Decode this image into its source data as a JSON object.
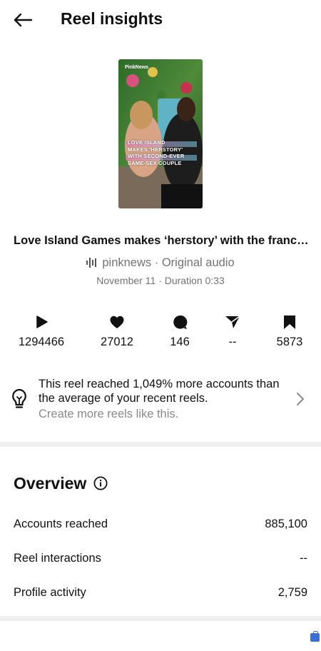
{
  "header": {
    "title": "Reel insights"
  },
  "thumbnail": {
    "brand_text": "PinkNews",
    "caption_lines": [
      "LOVE ISLAND",
      "MAKES 'HERSTORY'",
      "WITH SECOND-EVER",
      "SAME-SEX COUPLE"
    ]
  },
  "reel": {
    "title": "Love Island Games makes ‘herstory’ with the franchise...",
    "audio_account": "pinknews",
    "audio_separator": " · ",
    "audio_label": "Original audio",
    "date": "November 11",
    "duration_separator": " · ",
    "duration": "Duration 0:33"
  },
  "stats": [
    {
      "icon": "play-icon",
      "value": "1294466"
    },
    {
      "icon": "heart-icon",
      "value": "27012"
    },
    {
      "icon": "comment-icon",
      "value": "146"
    },
    {
      "icon": "send-icon",
      "value": "--"
    },
    {
      "icon": "bookmark-icon",
      "value": "5873"
    }
  ],
  "insight": {
    "text": "This reel reached 1,049% more accounts than the average of your recent reels.",
    "subtext": "Create more reels like this."
  },
  "overview": {
    "title": "Overview",
    "rows": [
      {
        "label": "Accounts reached",
        "value": "885,100"
      },
      {
        "label": "Reel interactions",
        "value": "--"
      },
      {
        "label": "Profile activity",
        "value": "2,759"
      }
    ]
  },
  "colors": {
    "text_primary": "#111111",
    "text_secondary": "#737373",
    "divider": "#efefef",
    "accent_badge": "#3b6fd8"
  }
}
